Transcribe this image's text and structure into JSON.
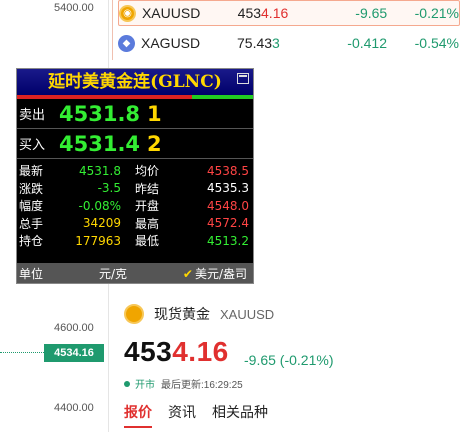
{
  "axis": {
    "ticks": [
      "5400.00",
      "4600.00",
      "4400.00"
    ],
    "current_price": "4534.16"
  },
  "quotes": [
    {
      "symbol": "XAUUSD",
      "icon": "gold-icon",
      "price_main": "453",
      "price_hi": "4.16",
      "change": "-9.65",
      "pct": "-0.21%",
      "active": true
    },
    {
      "symbol": "XAGUSD",
      "icon": "silver-icon",
      "price_main": "75.43",
      "price_hi": "3",
      "change": "-0.412",
      "pct": "-0.54%",
      "active": false
    }
  ],
  "glnc": {
    "title": "延时美黄金连(GLNC)",
    "sell_label": "卖出",
    "sell_price": "4531.8",
    "sell_qty": "1",
    "buy_label": "买入",
    "buy_price": "4531.4",
    "buy_qty": "2",
    "rows": [
      {
        "k": "最新",
        "v": "4531.8",
        "vc": "green",
        "k2": "均价",
        "v2": "4538.5",
        "v2c": "red"
      },
      {
        "k": "涨跌",
        "v": "-3.5",
        "vc": "green",
        "k2": "昨结",
        "v2": "4535.3",
        "v2c": "white"
      },
      {
        "k": "幅度",
        "v": "-0.08%",
        "vc": "green",
        "k2": "开盘",
        "v2": "4548.0",
        "v2c": "red"
      },
      {
        "k": "总手",
        "v": "34209",
        "vc": "yellow",
        "k2": "最高",
        "v2": "4572.4",
        "v2c": "red"
      },
      {
        "k": "持仓",
        "v": "177963",
        "vc": "yellow",
        "k2": "最低",
        "v2": "4513.2",
        "v2c": "green"
      }
    ],
    "footer": {
      "unit_label": "单位",
      "unit": "元/克",
      "alt_unit": "美元/盎司"
    }
  },
  "detail": {
    "name": "现货黄金",
    "code": "XAUUSD",
    "price_main": "453",
    "price_hi": "4.16",
    "change": "-9.65 (-0.21%)",
    "status": "开市",
    "updated": "最后更新:16:29:25",
    "tabs": [
      "报价",
      "资讯",
      "相关品种"
    ]
  }
}
